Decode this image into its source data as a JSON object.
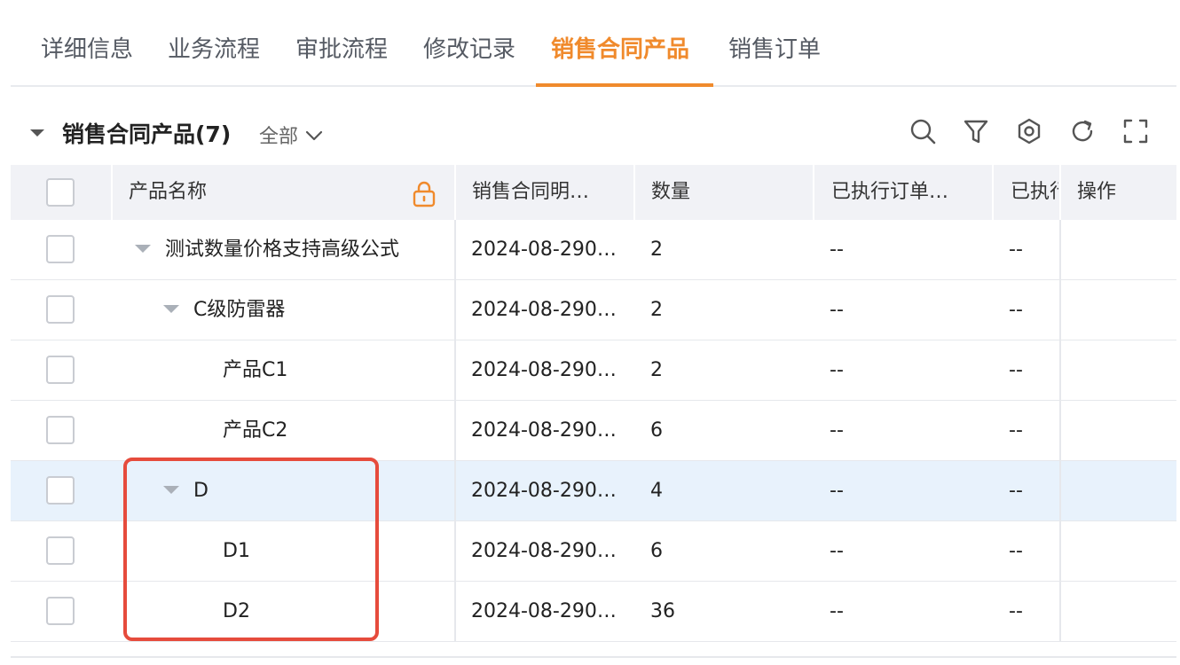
{
  "tabs": [
    {
      "label": "详细信息"
    },
    {
      "label": "业务流程"
    },
    {
      "label": "审批流程"
    },
    {
      "label": "修改记录"
    },
    {
      "label": "销售合同产品"
    },
    {
      "label": "销售订单"
    }
  ],
  "active_tab_index": 4,
  "section": {
    "title": "销售合同产品(7)",
    "filter_value": "全部"
  },
  "toolbar_icons": [
    "search-icon",
    "filter-icon",
    "settings-icon",
    "refresh-icon",
    "fullscreen-icon"
  ],
  "colors": {
    "accent": "#f08a2c",
    "highlight_row": "#e8f2fc",
    "annotation_box": "#e64b3c"
  },
  "table": {
    "headers": {
      "product_name": "产品名称",
      "contract_detail": "销售合同明…",
      "quantity": "数量",
      "executed_order": "已执行订单…",
      "executed_short": "已执行",
      "actions": "操作"
    },
    "rows": [
      {
        "name": "测试数量价格支持高级公式",
        "detail": "2024-08-290…",
        "qty": "2",
        "exec": "--",
        "exec2": "--"
      },
      {
        "name": "C级防雷器",
        "detail": "2024-08-290…",
        "qty": "2",
        "exec": "--",
        "exec2": "--"
      },
      {
        "name": "产品C1",
        "detail": "2024-08-290…",
        "qty": "2",
        "exec": "--",
        "exec2": "--"
      },
      {
        "name": "产品C2",
        "detail": "2024-08-290…",
        "qty": "6",
        "exec": "--",
        "exec2": "--"
      },
      {
        "name": "D",
        "detail": "2024-08-290…",
        "qty": "4",
        "exec": "--",
        "exec2": "--"
      },
      {
        "name": "D1",
        "detail": "2024-08-290…",
        "qty": "6",
        "exec": "--",
        "exec2": "--"
      },
      {
        "name": "D2",
        "detail": "2024-08-290…",
        "qty": "36",
        "exec": "--",
        "exec2": "--"
      }
    ]
  }
}
